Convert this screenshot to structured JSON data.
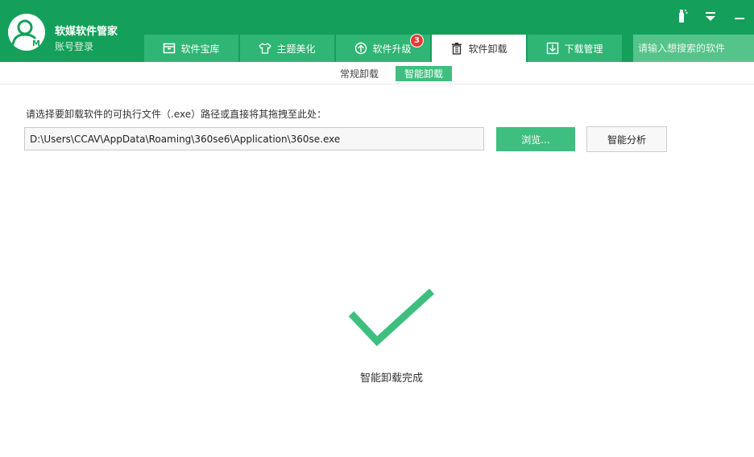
{
  "app": {
    "title": "软媒软件管家",
    "login_link": "账号登录"
  },
  "window_controls": [
    {
      "icon": "skin-icon"
    },
    {
      "icon": "menu-icon"
    },
    {
      "icon": "minimize-icon"
    }
  ],
  "tabs": [
    {
      "label": "软件宝库",
      "icon": "box-icon",
      "active": false
    },
    {
      "label": "主题美化",
      "icon": "tshirt-icon",
      "active": false
    },
    {
      "label": "软件升级",
      "icon": "upgrade-icon",
      "active": false,
      "badge": "3"
    },
    {
      "label": "软件卸载",
      "icon": "trash-icon",
      "active": true
    },
    {
      "label": "下载管理",
      "icon": "download-icon",
      "active": false
    }
  ],
  "search": {
    "placeholder": "请输入想搜索的软件"
  },
  "subtabs": [
    {
      "label": "常规卸载",
      "active": false
    },
    {
      "label": "智能卸载",
      "active": true
    }
  ],
  "main": {
    "instruction": "请选择要卸载软件的可执行文件（.exe）路径或直接将其拖拽至此处：",
    "path_value": "D:\\Users\\CCAV\\AppData\\Roaming\\360se6\\Application\\360se.exe",
    "browse_label": "浏览...",
    "analyze_label": "智能分析",
    "status_icon": "checkmark-icon",
    "status_text": "智能卸载完成"
  },
  "colors": {
    "brand_green": "#14a05a",
    "tab_green": "#2fb574",
    "accent_green": "#3fbf7f",
    "badge_red": "#e53935"
  }
}
